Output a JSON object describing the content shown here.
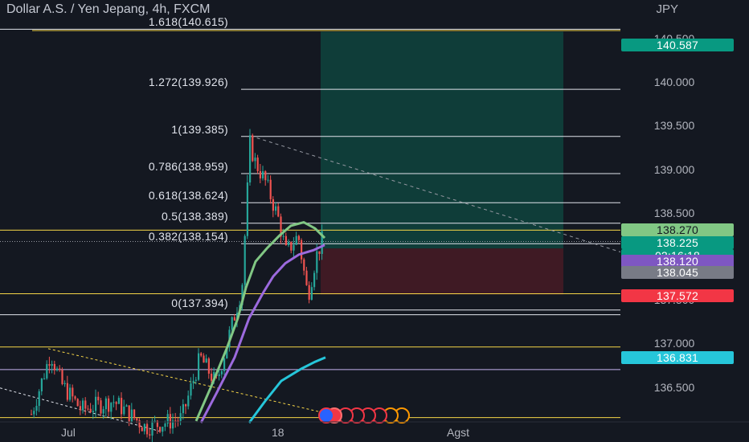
{
  "header": {
    "title": "Dollar A.S. / Yen Jepang, 4h, FXCM",
    "currency": "JPY"
  },
  "fib_labels": [
    {
      "text": "1.618(140.615)",
      "value": 140.615
    },
    {
      "text": "1.272(139.926)",
      "value": 139.926
    },
    {
      "text": "1(139.385)",
      "value": 139.385
    },
    {
      "text": "0.786(138.959)",
      "value": 138.959
    },
    {
      "text": "0.618(138.624)",
      "value": 138.624
    },
    {
      "text": "0.5(138.389)",
      "value": 138.389
    },
    {
      "text": "0.382(138.154)",
      "value": 138.154
    },
    {
      "text": "0(137.394)",
      "value": 137.394
    }
  ],
  "y_axis": [
    "140.500",
    "140.000",
    "139.500",
    "139.000",
    "138.500",
    "137.500",
    "137.000",
    "136.500"
  ],
  "x_axis": [
    "Jul",
    "18",
    "Agst"
  ],
  "price_tags": [
    {
      "label": "140.587",
      "value": 140.587,
      "color": "#089981"
    },
    {
      "label": "138.270",
      "value": 138.27,
      "color": "#81c784"
    },
    {
      "label": "138.225",
      "value": 138.225,
      "color": "#089981"
    },
    {
      "label": "02:16:18",
      "value": 138.15,
      "color": "#089981"
    },
    {
      "label": "138.120",
      "value": 138.12,
      "color": "#7e57c2"
    },
    {
      "label": "138.045",
      "value": 138.045,
      "color": "#787b86"
    },
    {
      "label": "137.572",
      "value": 137.572,
      "color": "#f23645"
    },
    {
      "label": "136.831",
      "value": 136.831,
      "color": "#26c6da"
    }
  ],
  "chart_data": {
    "type": "candlestick",
    "ylim": [
      136.11,
      140.95
    ],
    "fib_levels": [
      140.615,
      139.926,
      139.385,
      138.959,
      138.624,
      138.389,
      138.154,
      137.394
    ],
    "horizontal_lines": [
      {
        "value": 140.6,
        "color": "#f5d547"
      },
      {
        "value": 138.31,
        "color": "#f5d547"
      },
      {
        "value": 137.58,
        "color": "#f5d547"
      },
      {
        "value": 137.34,
        "color": "#e0e3eb"
      },
      {
        "value": 136.97,
        "color": "#f5d547"
      },
      {
        "value": 136.71,
        "color": "#c5b3f0"
      },
      {
        "value": 136.16,
        "color": "#f5d547"
      }
    ],
    "position": {
      "entry": 138.1,
      "target": 140.587,
      "stop": 137.572
    },
    "colors": {
      "up": "#26a69a",
      "down": "#ef5350",
      "ema_fast": "#81c784",
      "ema_mid": "#9c6ade",
      "ema_slow": "#26c6da"
    }
  }
}
